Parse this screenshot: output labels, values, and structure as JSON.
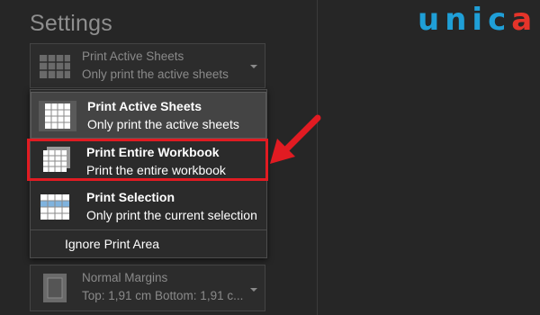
{
  "header": {
    "title": "Settings"
  },
  "logo": {
    "text_a": "unic",
    "text_b": "a"
  },
  "print_what": {
    "title": "Print Active Sheets",
    "subtitle": "Only print the active sheets"
  },
  "menu": {
    "items": [
      {
        "title": "Print Active Sheets",
        "subtitle": "Only print the active sheets",
        "icon": "active-sheets-icon"
      },
      {
        "title": "Print Entire Workbook",
        "subtitle": "Print the entire workbook",
        "icon": "entire-workbook-icon"
      },
      {
        "title": "Print Selection",
        "subtitle": "Only print the current selection",
        "icon": "selection-icon"
      }
    ],
    "ignore_label": "Ignore Print Area"
  },
  "margins": {
    "title": "Normal Margins",
    "subtitle": "Top: 1,91 cm Bottom: 1,91 c..."
  },
  "colors": {
    "highlight": "#e11b22",
    "logo_blue": "#1f9fd7",
    "logo_red": "#e5342a"
  }
}
